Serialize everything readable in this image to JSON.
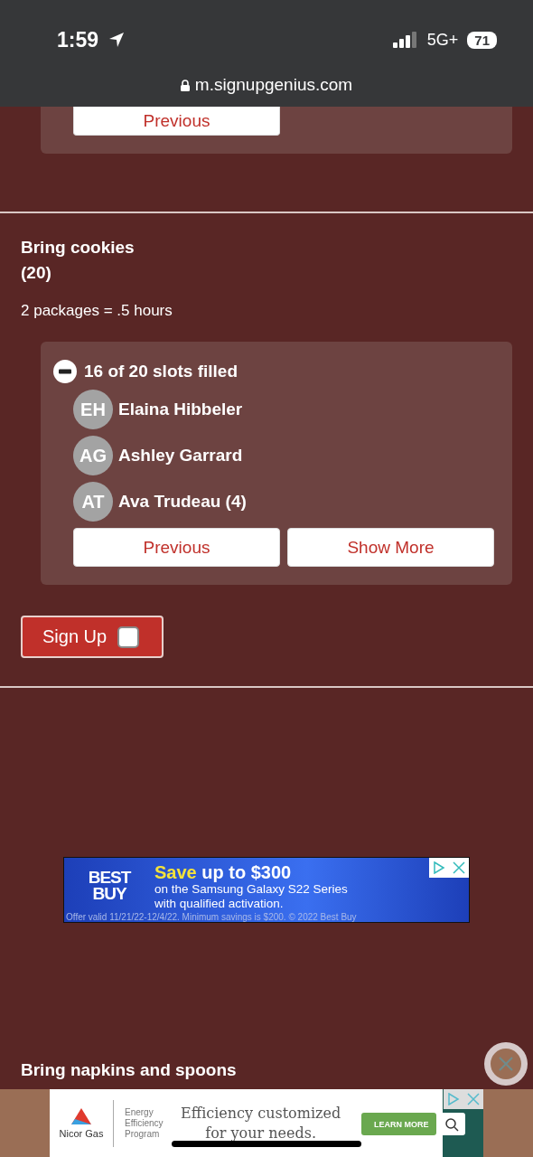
{
  "status_bar": {
    "time": "1:59",
    "network": "5G+",
    "battery": "71"
  },
  "address_bar": {
    "url": "m.signupgenius.com"
  },
  "previous_card": {
    "button": "Previous"
  },
  "slot": {
    "title": "Bring cookies",
    "quantity": "(20)",
    "description": "2 packages = .5 hours",
    "summary": "16 of 20 slots filled",
    "expanded": true,
    "people": [
      {
        "initials": "EH",
        "name": "Elaina Hibbeler"
      },
      {
        "initials": "AG",
        "name": "Ashley Garrard"
      },
      {
        "initials": "AT",
        "name": "Ava Trudeau (4)"
      }
    ],
    "buttons": [
      "Previous",
      "Show More"
    ],
    "signup": {
      "label": "Sign Up",
      "checked": false
    }
  },
  "banner_ad": {
    "brand_lines": [
      "BEST",
      "BUY"
    ],
    "headline_highlight": "Save",
    "headline": "up to $300",
    "lines": [
      "on the Samsung Galaxy S22 Series",
      "with qualified activation."
    ],
    "fine_print": "Offer valid 11/21/22-12/4/22. Minimum savings is $200. © 2022 Best Buy"
  },
  "next_slot": {
    "title": "Bring napkins and spoons"
  },
  "bottom_ad": {
    "brand": "Nicor Gas",
    "program_lines": [
      "Energy",
      "Efficiency",
      "Program"
    ],
    "headline": "Efficiency customized for your needs.",
    "button": "LEARN MORE"
  }
}
